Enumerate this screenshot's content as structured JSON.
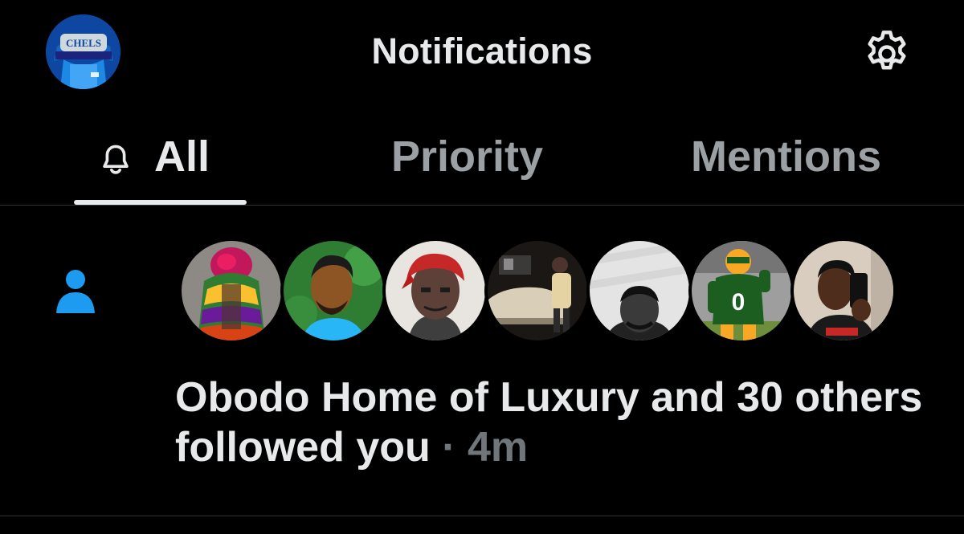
{
  "header": {
    "title": "Notifications",
    "profile_icon": "account-avatar",
    "settings_icon": "gear-icon"
  },
  "tabs": [
    {
      "label": "All",
      "icon": "bell-icon",
      "selected": true
    },
    {
      "label": "Priority",
      "selected": false
    },
    {
      "label": "Mentions",
      "selected": false
    }
  ],
  "notification": {
    "type_icon": "person-icon",
    "text": "Obodo Home of Luxury and 30 others followed you",
    "separator": "·",
    "time": "4m",
    "avatar_count": 7
  },
  "colors": {
    "background": "#000000",
    "text_primary": "#e7e9ea",
    "text_secondary": "#71767b",
    "accent": "#1d9bf0",
    "divider": "#2f3336"
  }
}
